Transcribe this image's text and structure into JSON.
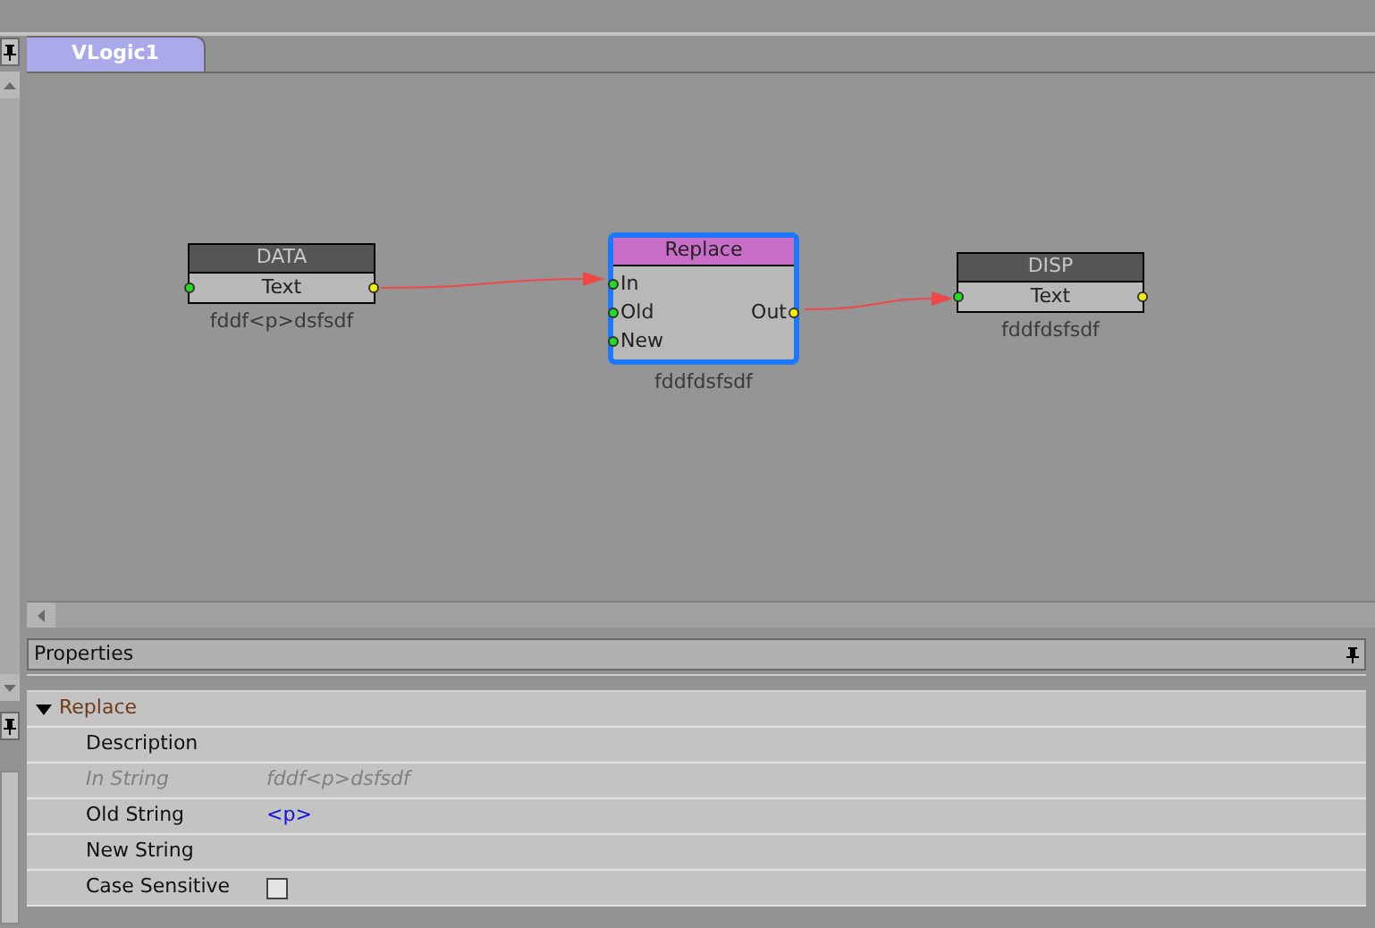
{
  "tabs": [
    {
      "label": "VLogic1",
      "selected": true
    }
  ],
  "nodes": [
    {
      "title": "DATA",
      "color": "#555555",
      "selected": false,
      "caption": "fddf<p>dsfsdf",
      "rows": [
        {
          "label": "Text",
          "input": true,
          "output": true
        }
      ]
    },
    {
      "title": "Replace",
      "color": "#c86ec8",
      "selected": true,
      "caption": "fddfdsfsdf",
      "rows": [
        {
          "label": "In",
          "input": true,
          "output": false
        },
        {
          "label": "Old",
          "input": true,
          "output": true,
          "out_label": "Out"
        },
        {
          "label": "New",
          "input": true,
          "output": false
        }
      ]
    },
    {
      "title": "DISP",
      "color": "#555555",
      "selected": false,
      "caption": "fddfdsfsdf",
      "rows": [
        {
          "label": "Text",
          "input": true,
          "output": true
        }
      ]
    }
  ],
  "properties": {
    "title": "Properties",
    "group": {
      "label": "Replace",
      "expanded": true
    },
    "rows": [
      {
        "kind": "text",
        "label": "Description",
        "disabled": false
      },
      {
        "kind": "text",
        "label": "In String",
        "value": "fddf<p>dsfsdf",
        "disabled": true
      },
      {
        "kind": "text",
        "label": "Old String",
        "value": "<p>",
        "disabled": false,
        "modified": true
      },
      {
        "kind": "text",
        "label": "New String",
        "disabled": false
      },
      {
        "kind": "checkbox",
        "label": "Case Sensitive",
        "disabled": false,
        "checked": false
      }
    ]
  }
}
